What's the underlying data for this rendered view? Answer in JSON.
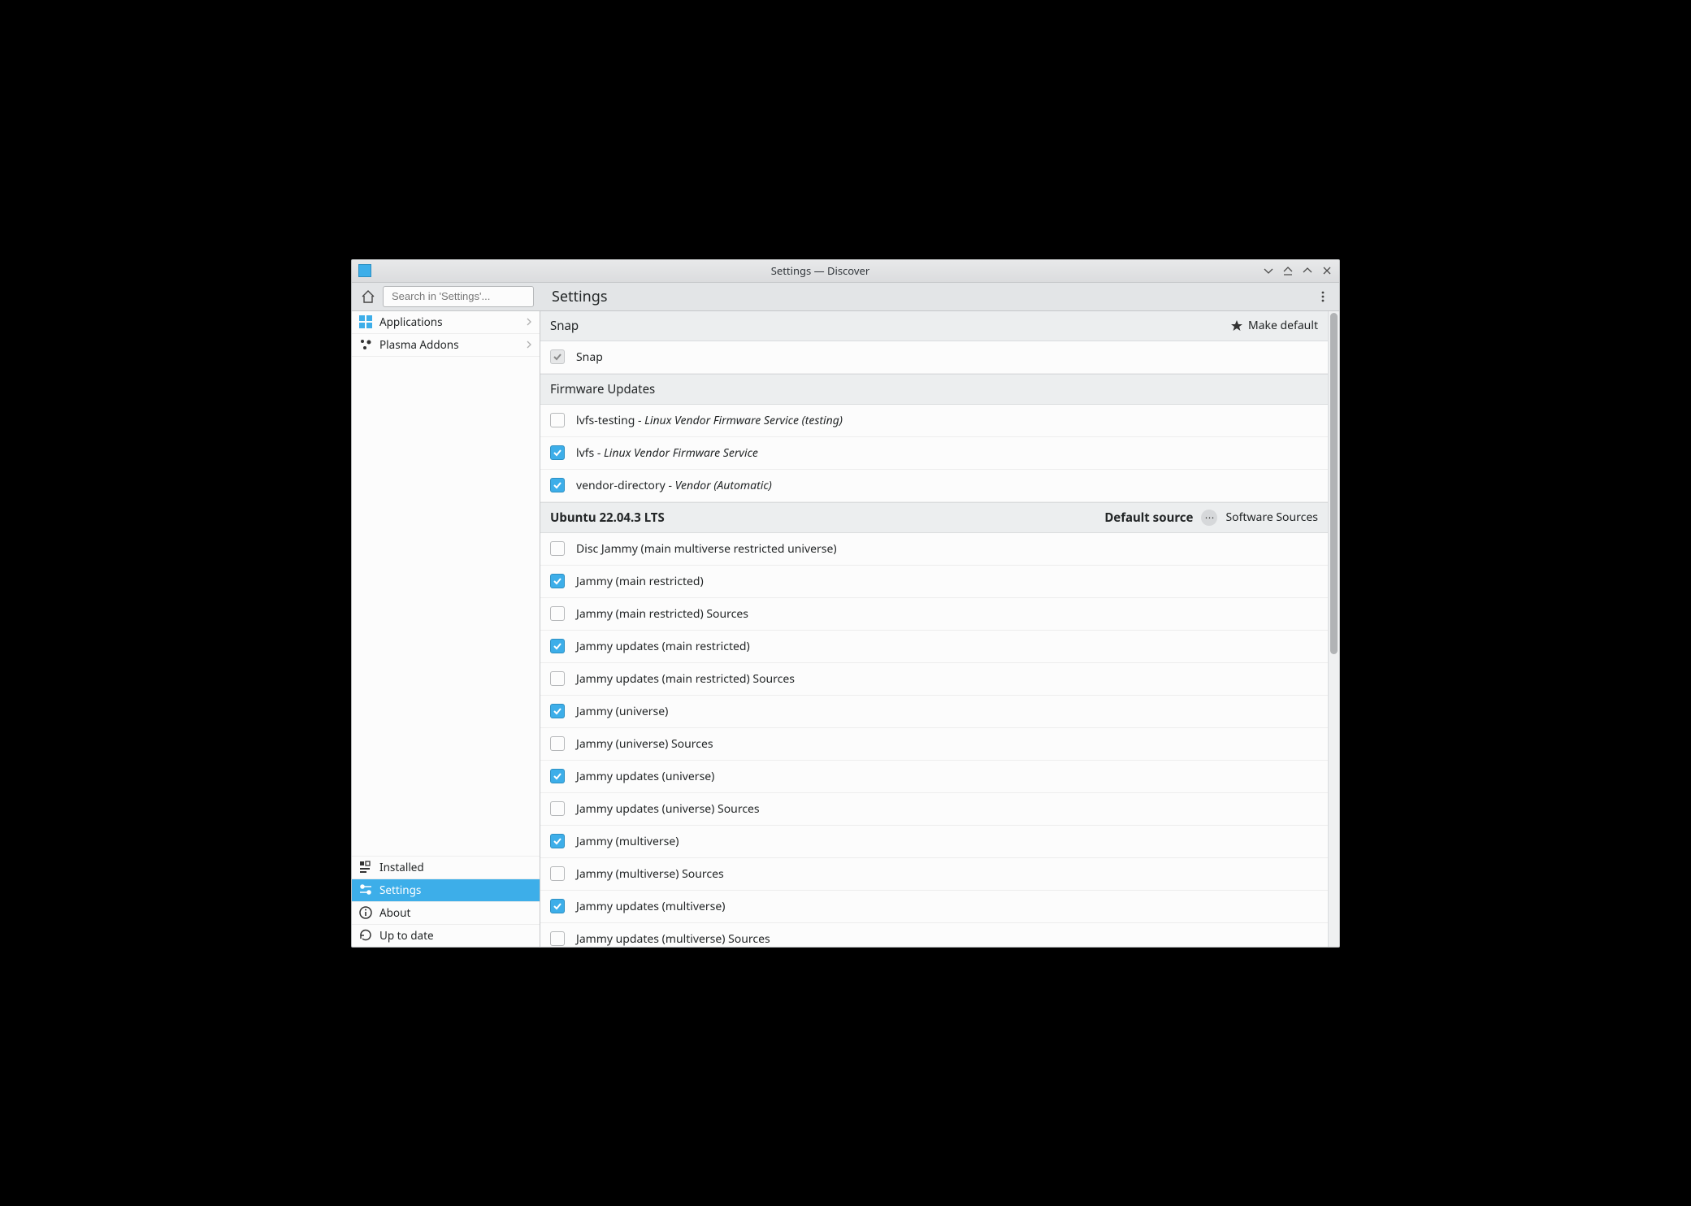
{
  "window": {
    "title": "Settings — Discover"
  },
  "toolbar": {
    "search_placeholder": "Search in 'Settings'...",
    "page_title": "Settings"
  },
  "sidebar": {
    "top": [
      {
        "key": "applications",
        "label": "Applications"
      },
      {
        "key": "plasma-addons",
        "label": "Plasma Addons"
      }
    ],
    "bottom": [
      {
        "key": "installed",
        "label": "Installed",
        "active": false
      },
      {
        "key": "settings",
        "label": "Settings",
        "active": true
      },
      {
        "key": "about",
        "label": "About",
        "active": false
      },
      {
        "key": "uptodate",
        "label": "Up to date",
        "active": false
      }
    ]
  },
  "sections": [
    {
      "id": "snap",
      "title": "Snap",
      "bold": false,
      "action": {
        "type": "make-default",
        "label": "Make default"
      },
      "rows": [
        {
          "checked": true,
          "disabled": true,
          "name": "Snap",
          "desc": ""
        }
      ]
    },
    {
      "id": "firmware",
      "title": "Firmware Updates",
      "bold": false,
      "action": null,
      "rows": [
        {
          "checked": false,
          "disabled": false,
          "name": "lvfs-testing - ",
          "desc": "Linux Vendor Firmware Service (testing)"
        },
        {
          "checked": true,
          "disabled": false,
          "name": "lvfs - ",
          "desc": "Linux Vendor Firmware Service"
        },
        {
          "checked": true,
          "disabled": false,
          "name": "vendor-directory - ",
          "desc": "Vendor (Automatic)"
        }
      ]
    },
    {
      "id": "ubuntu",
      "title": "Ubuntu 22.04.3 LTS",
      "bold": true,
      "badge": "Default source",
      "action": {
        "type": "software-sources",
        "label": "Software Sources"
      },
      "rows": [
        {
          "checked": false,
          "disabled": false,
          "name": "Disc Jammy (main multiverse restricted universe)",
          "desc": ""
        },
        {
          "checked": true,
          "disabled": false,
          "name": "Jammy (main restricted)",
          "desc": ""
        },
        {
          "checked": false,
          "disabled": false,
          "name": "Jammy (main restricted) Sources",
          "desc": ""
        },
        {
          "checked": true,
          "disabled": false,
          "name": "Jammy updates (main restricted)",
          "desc": ""
        },
        {
          "checked": false,
          "disabled": false,
          "name": "Jammy updates (main restricted) Sources",
          "desc": ""
        },
        {
          "checked": true,
          "disabled": false,
          "name": "Jammy (universe)",
          "desc": ""
        },
        {
          "checked": false,
          "disabled": false,
          "name": "Jammy (universe) Sources",
          "desc": ""
        },
        {
          "checked": true,
          "disabled": false,
          "name": "Jammy updates (universe)",
          "desc": ""
        },
        {
          "checked": false,
          "disabled": false,
          "name": "Jammy updates (universe) Sources",
          "desc": ""
        },
        {
          "checked": true,
          "disabled": false,
          "name": "Jammy (multiverse)",
          "desc": ""
        },
        {
          "checked": false,
          "disabled": false,
          "name": "Jammy (multiverse) Sources",
          "desc": ""
        },
        {
          "checked": true,
          "disabled": false,
          "name": "Jammy updates (multiverse)",
          "desc": ""
        },
        {
          "checked": false,
          "disabled": false,
          "name": "Jammy updates (multiverse) Sources",
          "desc": ""
        }
      ]
    }
  ]
}
